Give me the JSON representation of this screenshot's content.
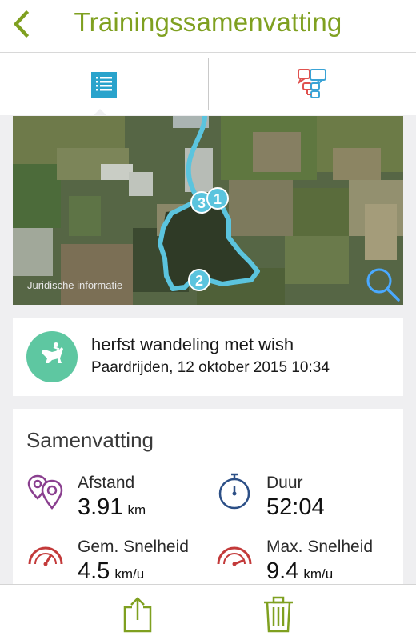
{
  "navbar": {
    "title": "Trainingssamenvatting"
  },
  "map": {
    "legal_link": "Juridische informatie",
    "markers": [
      "3",
      "1",
      "2"
    ]
  },
  "activity": {
    "name": "herfst wandeling met wish",
    "subtitle": "Paardrijden, 12 oktober 2015 10:34"
  },
  "summary": {
    "title": "Samenvatting",
    "distance": {
      "label": "Afstand",
      "value": "3.91",
      "unit": "km"
    },
    "duration": {
      "label": "Duur",
      "value": "52:04"
    },
    "avg_speed": {
      "label": "Gem. Snelheid",
      "value": "4.5",
      "unit": "km/u"
    },
    "max_speed": {
      "label": "Max. Snelheid",
      "value": "9.4",
      "unit": "km/u"
    }
  },
  "colors": {
    "accent": "#7fa020",
    "route": "#5bc4de",
    "tab_active": "#29a3cc",
    "avatar": "#5ec7a1",
    "speed_icon": "#c33a3a",
    "distance_icon": "#8a3f8f",
    "duration_icon": "#2c4f86"
  }
}
